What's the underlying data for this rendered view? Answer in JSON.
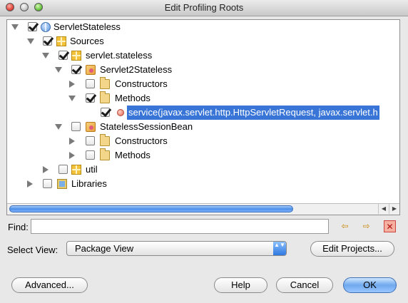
{
  "window": {
    "title": "Edit Profiling Roots"
  },
  "tree": {
    "nodes": [
      {
        "label": "ServletStateless",
        "icon": "project-globe-icon",
        "checked": true,
        "expanded": true
      },
      {
        "label": "Sources",
        "icon": "package-icon",
        "checked": true,
        "expanded": true
      },
      {
        "label": "servlet.stateless",
        "icon": "package-icon",
        "checked": true,
        "expanded": true
      },
      {
        "label": "Servlet2Stateless",
        "icon": "class-icon",
        "checked": true,
        "expanded": true
      },
      {
        "label": "Constructors",
        "icon": "folder-icon",
        "checked": false,
        "expanded": false
      },
      {
        "label": "Methods",
        "icon": "folder-icon",
        "checked": true,
        "expanded": true
      },
      {
        "label": "service(javax.servlet.http.HttpServletRequest, javax.servlet.h",
        "icon": "method-icon",
        "checked": true,
        "selected": true
      },
      {
        "label": "StatelessSessionBean",
        "icon": "class-icon",
        "checked": false,
        "expanded": true
      },
      {
        "label": "Constructors",
        "icon": "folder-icon",
        "checked": false,
        "expanded": false
      },
      {
        "label": "Methods",
        "icon": "folder-icon",
        "checked": false,
        "expanded": false
      },
      {
        "label": "util",
        "icon": "package-icon",
        "checked": false,
        "expanded": false
      },
      {
        "label": "Libraries",
        "icon": "library-icon",
        "checked": false,
        "expanded": false
      }
    ]
  },
  "scroll": {
    "left_arrow": "◀",
    "right_arrow": "▶"
  },
  "find": {
    "label": "Find:",
    "value": "",
    "prev_icon": "⇦",
    "next_icon": "⇨",
    "clear_icon": "✕"
  },
  "view": {
    "label": "Select View:",
    "selected": "Package View",
    "caret": "▲▼"
  },
  "buttons": {
    "edit_projects": "Edit Projects...",
    "advanced": "Advanced...",
    "help": "Help",
    "cancel": "Cancel",
    "ok": "OK"
  }
}
